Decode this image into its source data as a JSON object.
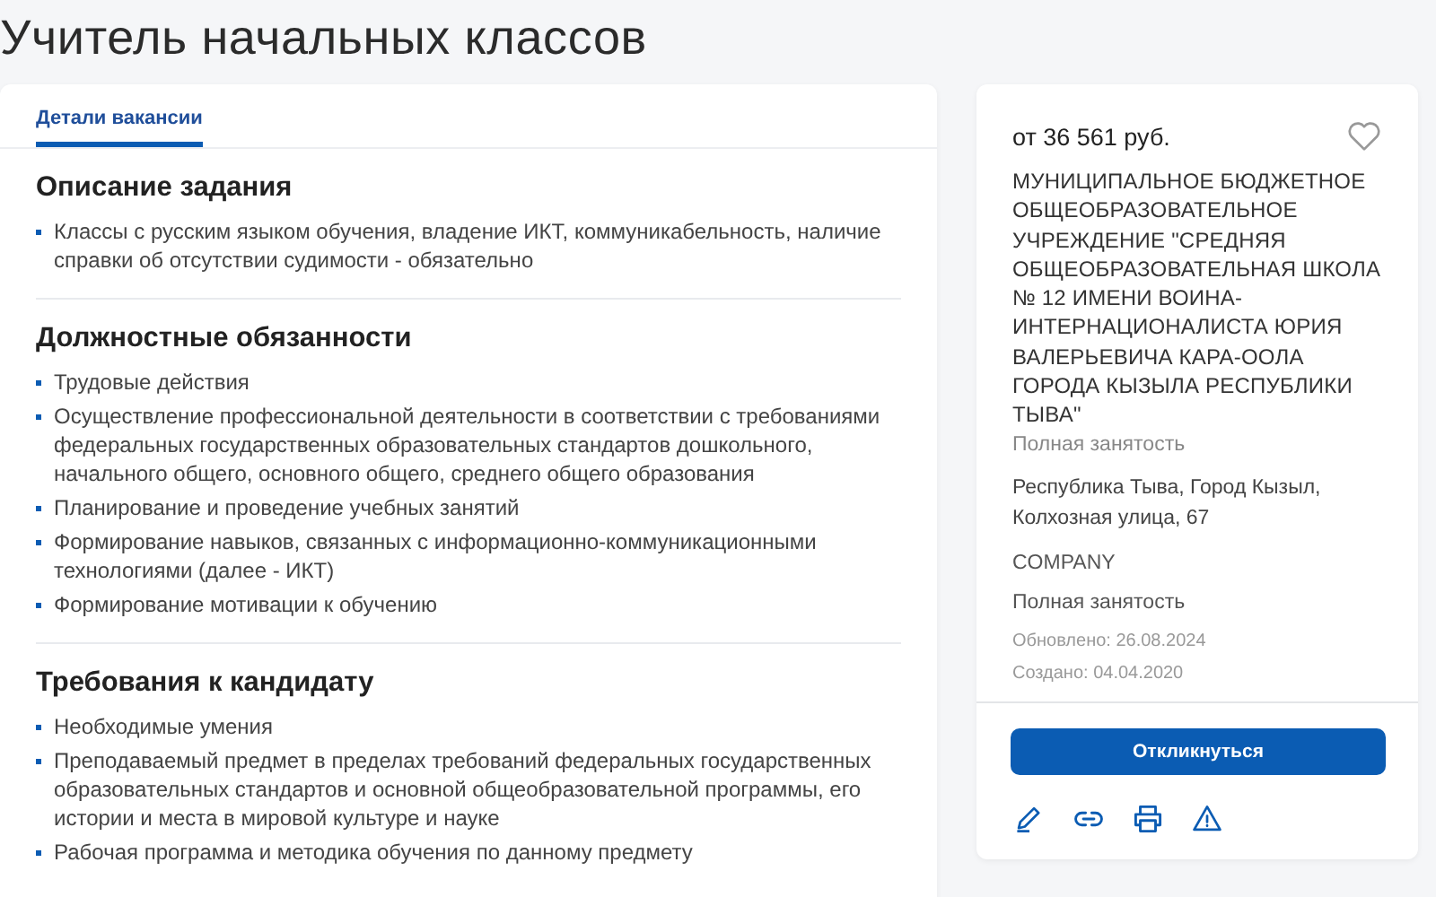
{
  "title": "Учитель начальных классов",
  "tabs": [
    {
      "label": "Детали вакансии",
      "selected": true
    }
  ],
  "sections": [
    {
      "heading": "Описание задания",
      "items": [
        "Классы с русским языком обучения, владение ИКТ, коммуникабельность, наличие справки об отсутствии судимости - обязательно"
      ]
    },
    {
      "heading": "Должностные обязанности",
      "items": [
        "Трудовые действия",
        "Осуществление профессиональной деятельности в соответствии с требованиями федеральных государственных образовательных стандартов дошкольного, начального общего, основного общего, среднего общего образования",
        "Планирование и проведение учебных занятий",
        "Формирование навыков, связанных с информационно-коммуникационными технологиями (далее - ИКТ)",
        "Формирование мотивации к обучению"
      ]
    },
    {
      "heading": "Требования к кандидату",
      "items": [
        "Необходимые умения",
        "Преподаваемый предмет в пределах требований федеральных государственных образовательных стандартов и основной общеобразовательной программы, его истории и места в мировой культуре и науке",
        "Рабочая программа и методика обучения по данному предмету"
      ]
    }
  ],
  "sidebar": {
    "salary": "от 36 561 руб.",
    "favorite": false,
    "employer": "МУНИЦИПАЛЬНОЕ БЮДЖЕТНОЕ ОБЩЕОБРАЗОВАТЕЛЬНОЕ УЧРЕЖДЕНИЕ \"СРЕДНЯЯ ОБЩЕОБРАЗОВАТЕЛЬНАЯ ШКОЛА № 12 ИМЕНИ ВОИНА-ИНТЕРНАЦИОНАЛИСТА ЮРИЯ ВАЛЕРЬЕВИЧА КАРА-ООЛА ГОРОДА КЫЗЫЛА РЕСПУБЛИКИ ТЫВА\"",
    "employment_type": "Полная занятость",
    "address": "Республика Тыва, Город Кызыл, Колхозная улица, 67",
    "company": "COMPANY",
    "schedule": "Полная занятость",
    "updated": "Обновлено: 26.08.2024",
    "created": "Создано: 04.04.2020",
    "apply_button": "Откликнуться",
    "actions": [
      {
        "kind": "edit"
      },
      {
        "kind": "link"
      },
      {
        "kind": "print"
      },
      {
        "kind": "report"
      }
    ]
  }
}
